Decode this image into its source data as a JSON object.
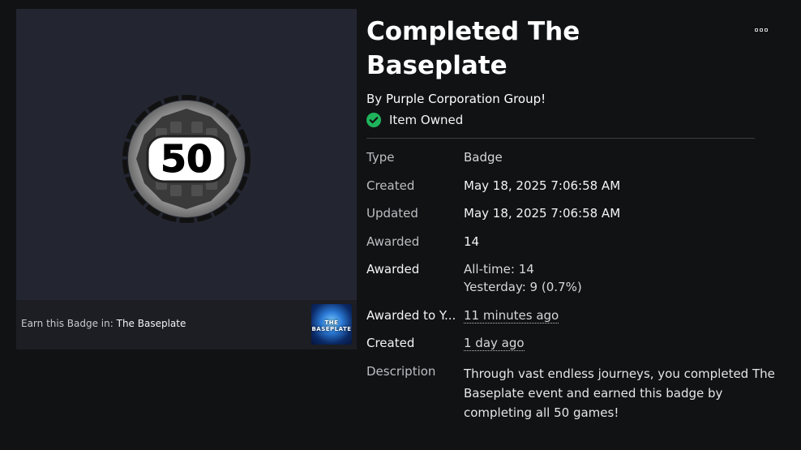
{
  "badge": {
    "number_text": "50",
    "title": "Completed The Baseplate",
    "by_prefix": "By",
    "creator": "Purple Corporation Group!",
    "owned_text": "Item Owned"
  },
  "earn": {
    "prefix": "Earn this Badge in:",
    "game": "The Baseplate",
    "thumb_text": "THE BASEPLATE"
  },
  "details": {
    "type_label": "Type",
    "type_value": "Badge",
    "created_label": "Created",
    "created_value": "May 18, 2025 7:06:58 AM",
    "updated_label": "Updated",
    "updated_value": "May 18, 2025 7:06:58 AM",
    "awarded_label": "Awarded",
    "awarded_value": "14",
    "awarded_stats_label": "Awarded",
    "alltime_value": "All-time: 14",
    "yesterday_value": "Yesterday: 9 (0.7%)",
    "awarded_to_label": "Awarded to Y...",
    "awarded_to_value": "11 minutes ago",
    "created_rel_label": "Created",
    "created_rel_value": "1 day ago",
    "description_label": "Description",
    "description_value": "Through vast endless journeys, you completed The Baseplate event and earned this badge by completing all 50 games!"
  },
  "colors": {
    "background": "#111214",
    "panel": "#232630",
    "owned_check": "#1fb35b"
  },
  "icons": {
    "more": "more-options-icon",
    "owned": "check-circle-icon"
  }
}
